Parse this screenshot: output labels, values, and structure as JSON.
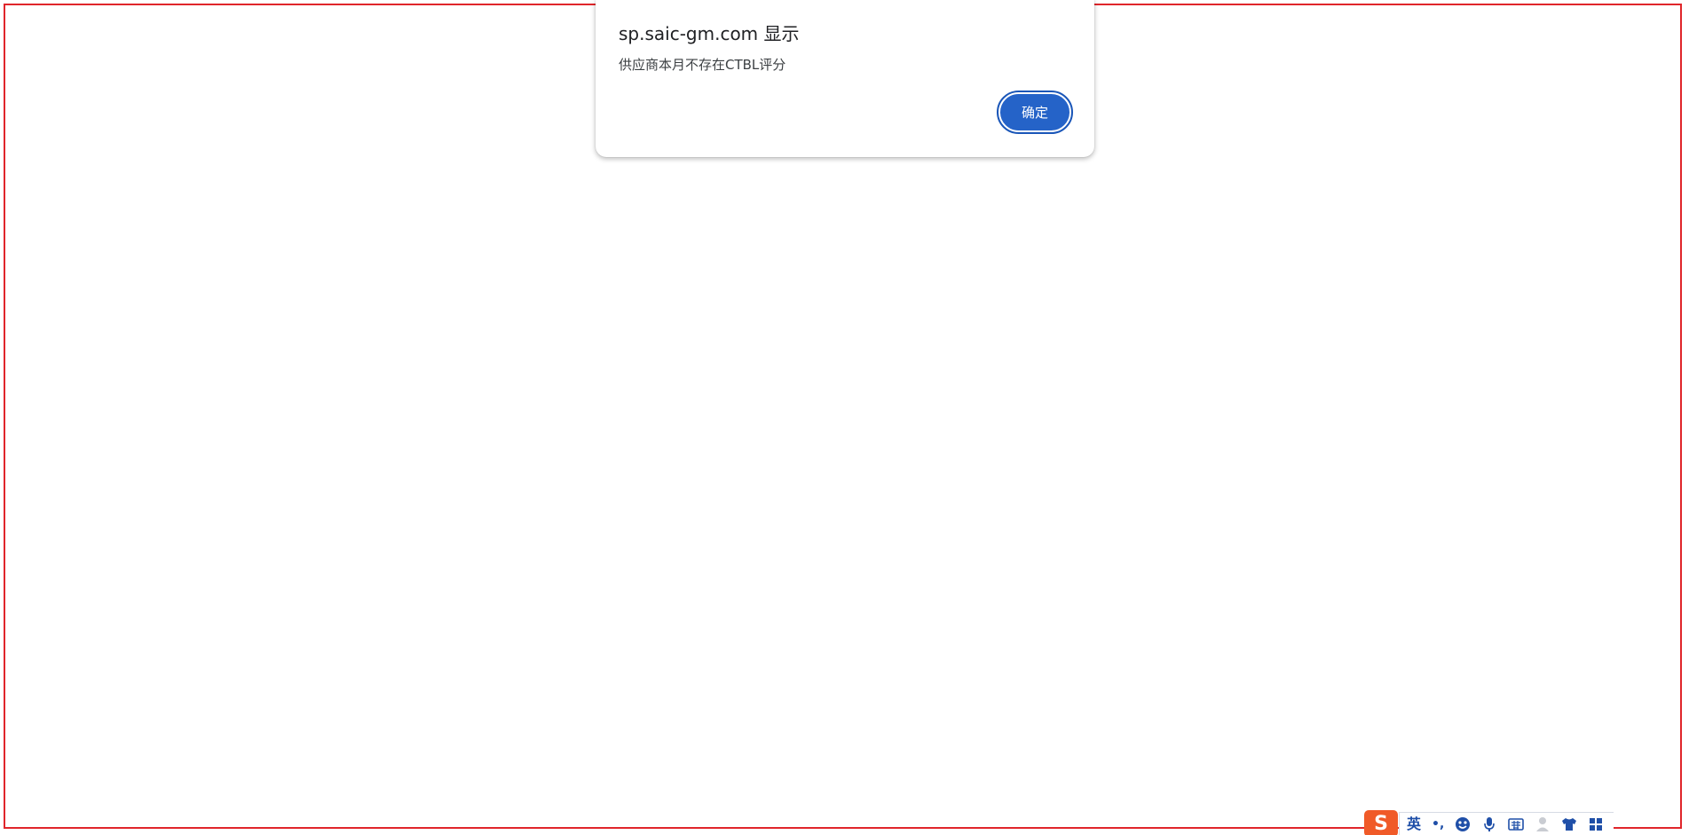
{
  "dialog": {
    "title": "sp.saic-gm.com 显示",
    "message": "供应商本月不存在CTBL评分",
    "ok_label": "确定"
  },
  "ime_toolbar": {
    "mode_label": "英",
    "punctuation_label": "•,",
    "icons": [
      "sogou-logo-icon",
      "emoji-icon",
      "microphone-icon",
      "keyboard-icon",
      "user-icon",
      "skin-icon",
      "toolbox-icon"
    ]
  },
  "colors": {
    "frame_border": "#e0262b",
    "button_bg": "#2563c8",
    "ime_blue": "#1f4fa8",
    "ime_logo_orange": "#f05a28"
  }
}
